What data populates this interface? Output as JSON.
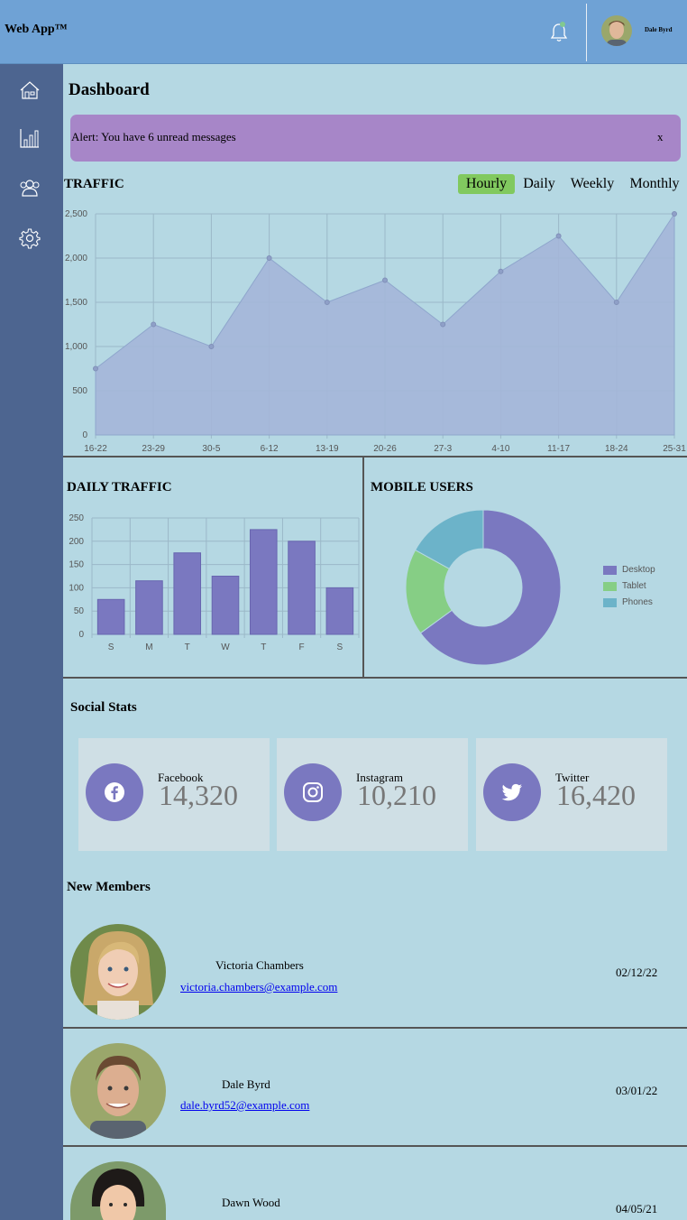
{
  "app": {
    "title": "Web App™"
  },
  "header": {
    "user_name": "Dale Byrd",
    "notifications_icon": "bell-icon"
  },
  "sidebar": {
    "items": [
      {
        "icon": "home-icon"
      },
      {
        "icon": "bar-chart-icon"
      },
      {
        "icon": "users-icon"
      },
      {
        "icon": "gear-icon"
      }
    ]
  },
  "page": {
    "title": "Dashboard"
  },
  "alert": {
    "text": "Alert: You have 6 unread messages",
    "close_label": "x"
  },
  "traffic": {
    "title": "TRAFFIC",
    "tabs": [
      "Hourly",
      "Daily",
      "Weekly",
      "Monthly"
    ],
    "active_tab": "Hourly"
  },
  "daily_traffic": {
    "title": "DAILY TRAFFIC"
  },
  "mobile_users": {
    "title": "MOBILE USERS"
  },
  "social": {
    "title": "Social Stats",
    "cards": [
      {
        "name": "Facebook",
        "count": "14,320",
        "icon": "facebook-icon"
      },
      {
        "name": "Instagram",
        "count": "10,210",
        "icon": "instagram-icon"
      },
      {
        "name": "Twitter",
        "count": "16,420",
        "icon": "twitter-icon"
      }
    ]
  },
  "members": {
    "title": "New Members",
    "list": [
      {
        "name": "Victoria Chambers",
        "email": "victoria.chambers@example.com",
        "date": "02/12/22"
      },
      {
        "name": "Dale Byrd",
        "email": "dale.byrd52@example.com",
        "date": "03/01/22"
      },
      {
        "name": "Dawn Wood",
        "email": "",
        "date": "04/05/21"
      }
    ]
  },
  "colors": {
    "topbar": "#6fa2d5",
    "sidebar": "#4d6590",
    "background": "#b5d8e3",
    "alert": "#a786c8",
    "accent_purple": "#7a78c0",
    "accent_green": "#81c98f",
    "accent_teal": "#6cb3c9"
  },
  "chart_data": [
    {
      "type": "area",
      "categories": [
        "16-22",
        "23-29",
        "30-5",
        "6-12",
        "13-19",
        "20-26",
        "27-3",
        "4-10",
        "11-17",
        "18-24",
        "25-31"
      ],
      "values": [
        750,
        1250,
        1000,
        2000,
        1500,
        1750,
        1250,
        1850,
        2250,
        1500,
        2500
      ],
      "ylim": [
        0,
        2500
      ],
      "yticks": [
        "0",
        "500",
        "1,000",
        "1,500",
        "2,000",
        "2,500"
      ],
      "grid": true,
      "color": "#a4b6d8"
    },
    {
      "type": "bar",
      "categories": [
        "S",
        "M",
        "T",
        "W",
        "T",
        "F",
        "S"
      ],
      "values": [
        75,
        115,
        175,
        125,
        225,
        200,
        100
      ],
      "ylim": [
        0,
        250
      ],
      "yticks": [
        "0",
        "50",
        "100",
        "150",
        "200",
        "250"
      ],
      "grid": true,
      "color": "#7a78c0"
    },
    {
      "type": "pie",
      "labels": [
        "Desktop",
        "Tablet",
        "Phones"
      ],
      "values": [
        65,
        18,
        17
      ],
      "colors": [
        "#7a78c0",
        "#86ce85",
        "#6cb3c9"
      ],
      "legend": "right"
    }
  ]
}
